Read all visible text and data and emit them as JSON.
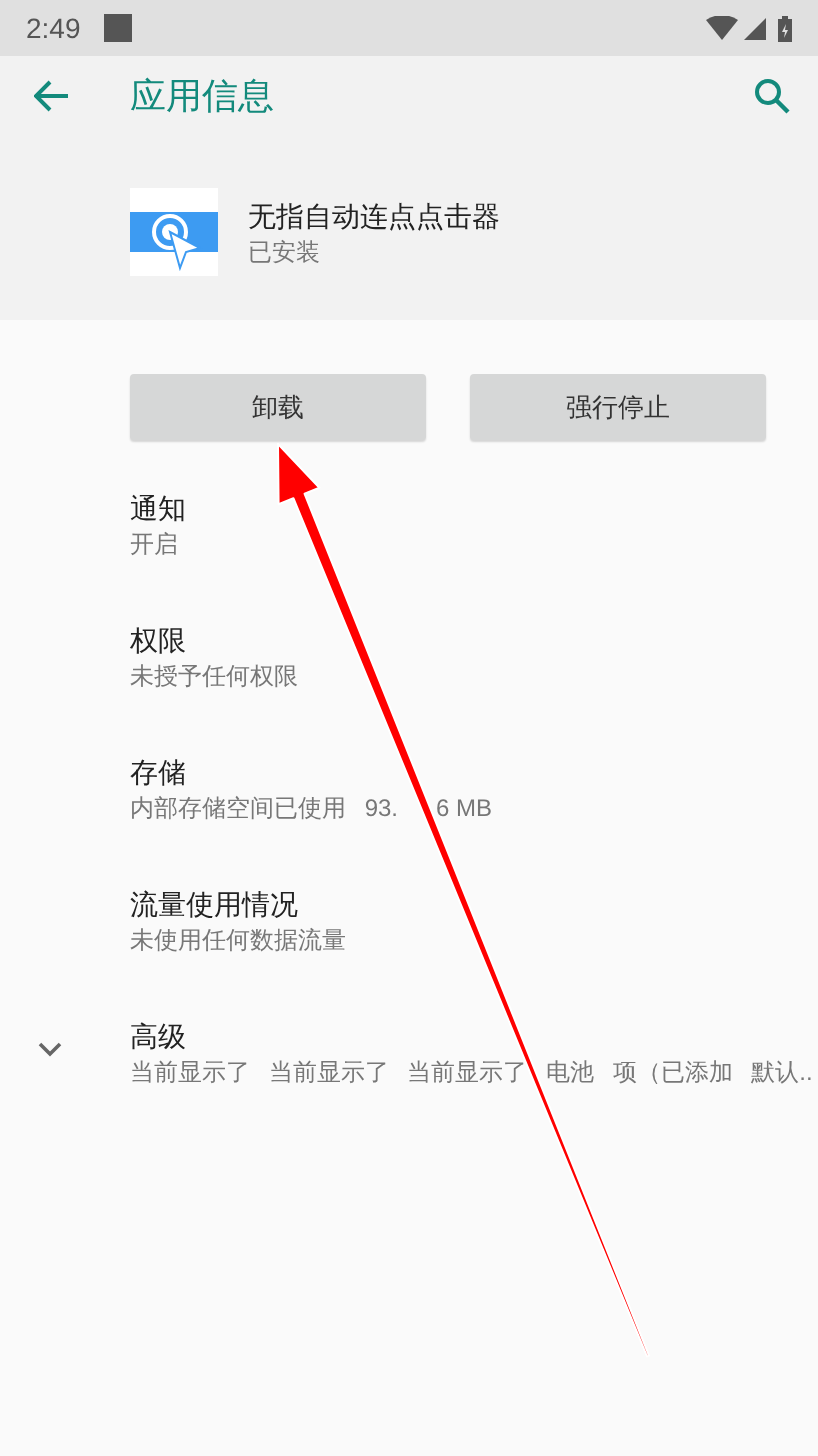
{
  "status_bar": {
    "time": "2:49"
  },
  "toolbar": {
    "title": "应用信息"
  },
  "app": {
    "name": "无指自动连点点击器",
    "status": "已安装"
  },
  "buttons": [
    {
      "label": "卸载"
    },
    {
      "label": "强行停止"
    }
  ],
  "items": [
    {
      "title": "通知",
      "subtitle": "开启"
    },
    {
      "title": "权限",
      "subtitle": "未授予任何权限"
    },
    {
      "title": "存储",
      "subtitle": "内部存储空间已使用 93.",
      "subtitle_end": "6 MB"
    },
    {
      "title": "流量使用情况",
      "subtitle": "未使用任何数据流量"
    },
    {
      "title": "高级",
      "subtitle": "当前显示了 当前显示了 当前显示了 电池 项（已添加 默认..",
      "expandable": true,
      "expanded": false
    }
  ]
}
